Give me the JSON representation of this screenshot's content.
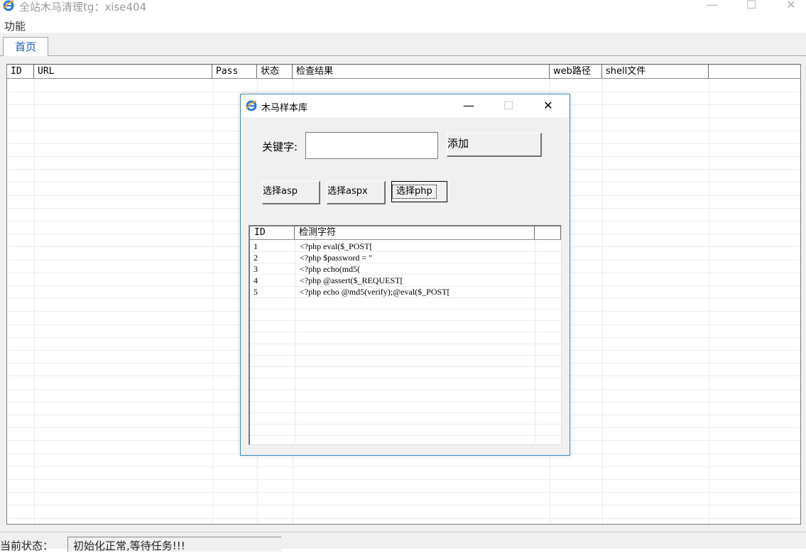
{
  "window": {
    "title": "全站木马清理tg：xise404",
    "icon": "ie-logo-icon",
    "controls": {
      "minimize": "—",
      "maximize": "☐",
      "close": "✕"
    }
  },
  "menu": {
    "items": [
      "功能"
    ]
  },
  "tabs": [
    {
      "label": "首页",
      "active": true
    }
  ],
  "main_list": {
    "columns": [
      "ID",
      "URL",
      "Pass",
      "状态",
      "检查结果",
      "web路径",
      "shell文件"
    ],
    "rows": []
  },
  "status": {
    "label": "当前状态：",
    "value": "初始化正常,等待任务!!!"
  },
  "dialog": {
    "title": "木马样本库",
    "controls": {
      "minimize": "—",
      "maximize": "☐",
      "close": "✕"
    },
    "keyword_label": "关键字:",
    "keyword_value": "",
    "add_button": "添加",
    "select_asp": "选择asp",
    "select_aspx": "选择aspx",
    "select_php": "选择php",
    "list": {
      "columns": [
        "ID",
        "检测字符"
      ],
      "rows": [
        {
          "id": "1",
          "pattern": "<?php eval($_POST["
        },
        {
          "id": "2",
          "pattern": "<?php $password = \""
        },
        {
          "id": "3",
          "pattern": "<?php echo(md5("
        },
        {
          "id": "4",
          "pattern": "<?php @assert($_REQUEST["
        },
        {
          "id": "5",
          "pattern": "<?php echo @md5(verify);@eval($_POST["
        }
      ]
    }
  },
  "colors": {
    "accent": "#1e5ab4",
    "dialog_border": "#3c8ac4",
    "chrome": "#f0f0f0"
  }
}
